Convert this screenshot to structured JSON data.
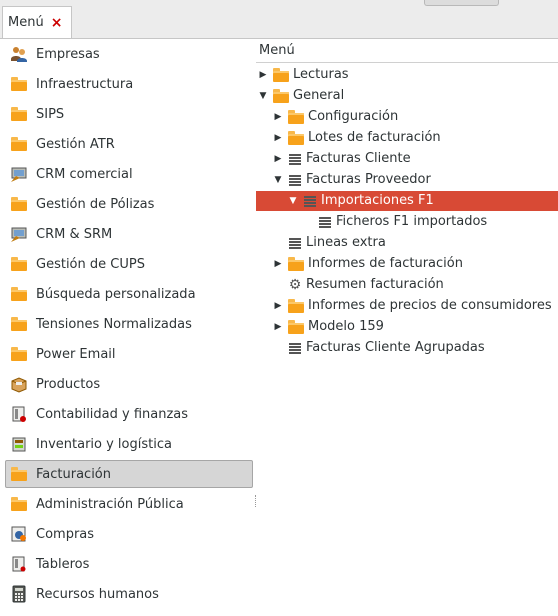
{
  "window": {
    "tab_label": "Menú",
    "tab_close": "×"
  },
  "menu": {
    "items": [
      {
        "label": "Empresas",
        "icon": "people-icon"
      },
      {
        "label": "Infraestructura",
        "icon": "folder-icon"
      },
      {
        "label": "SIPS",
        "icon": "folder-icon"
      },
      {
        "label": "Gestión ATR",
        "icon": "folder-icon"
      },
      {
        "label": "CRM comercial",
        "icon": "crm-icon"
      },
      {
        "label": "Gestión de Pólizas",
        "icon": "folder-icon"
      },
      {
        "label": "CRM & SRM",
        "icon": "crm-icon"
      },
      {
        "label": "Gestión de CUPS",
        "icon": "folder-icon"
      },
      {
        "label": "Búsqueda personalizada",
        "icon": "folder-icon"
      },
      {
        "label": "Tensiones Normalizadas",
        "icon": "folder-icon"
      },
      {
        "label": "Power Email",
        "icon": "folder-icon"
      },
      {
        "label": "Productos",
        "icon": "box-icon"
      },
      {
        "label": "Contabilidad y finanzas",
        "icon": "accounting-icon"
      },
      {
        "label": "Inventario y logística",
        "icon": "inventory-icon"
      },
      {
        "label": "Facturación",
        "icon": "folder-icon",
        "selected": true
      },
      {
        "label": "Administración Pública",
        "icon": "folder-icon"
      },
      {
        "label": "Compras",
        "icon": "purchases-icon"
      },
      {
        "label": "Tableros",
        "icon": "dashboard-icon"
      },
      {
        "label": "Recursos humanos",
        "icon": "calculator-icon"
      }
    ]
  },
  "tree": {
    "header": "Menú",
    "rows": [
      {
        "label": "Lecturas",
        "expander": "collapsed",
        "icon": "folder-icon"
      },
      {
        "label": "General",
        "expander": "expanded",
        "icon": "folder-icon"
      },
      {
        "label": "Configuración",
        "expander": "collapsed",
        "icon": "folder-icon"
      },
      {
        "label": "Lotes de facturación",
        "expander": "collapsed",
        "icon": "folder-icon"
      },
      {
        "label": "Facturas Cliente",
        "expander": "collapsed",
        "icon": "list-icon"
      },
      {
        "label": "Facturas Proveedor",
        "expander": "expanded",
        "icon": "list-icon"
      },
      {
        "label": "Importaciones F1",
        "expander": "expanded",
        "icon": "list-icon",
        "selected": true
      },
      {
        "label": "Ficheros F1 importados",
        "expander": "none",
        "icon": "list-icon"
      },
      {
        "label": "Lineas extra",
        "expander": "none",
        "icon": "list-icon"
      },
      {
        "label": "Informes de facturación",
        "expander": "collapsed",
        "icon": "folder-icon"
      },
      {
        "label": "Resumen facturación",
        "expander": "none",
        "icon": "gears-icon"
      },
      {
        "label": "Informes de precios de consumidores",
        "expander": "collapsed",
        "icon": "folder-icon"
      },
      {
        "label": "Modelo 159",
        "expander": "collapsed",
        "icon": "folder-icon"
      },
      {
        "label": "Facturas Cliente Agrupadas",
        "expander": "none",
        "icon": "list-icon"
      }
    ]
  },
  "colors": {
    "selection": "#d84a35",
    "folder": "#f7a21b"
  }
}
